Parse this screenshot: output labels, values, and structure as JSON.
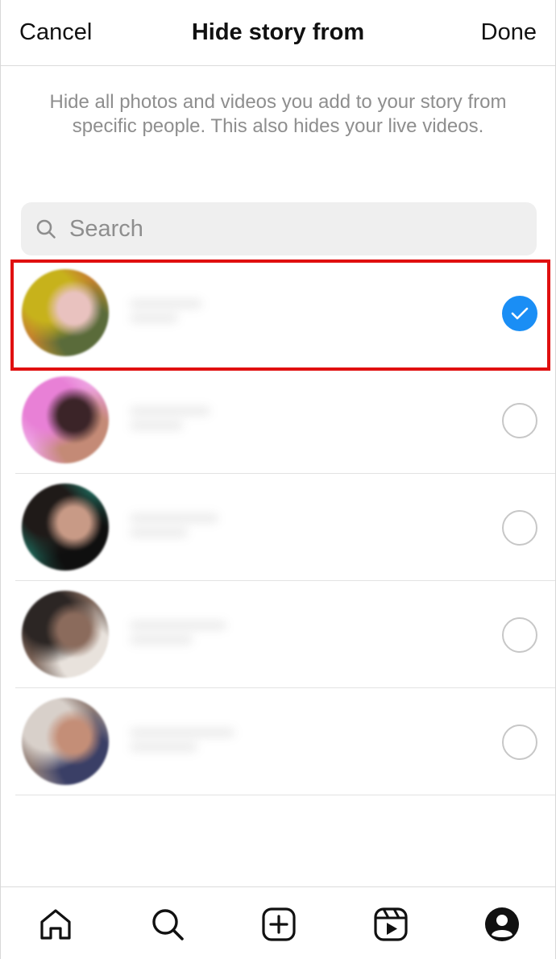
{
  "header": {
    "cancel_label": "Cancel",
    "title": "Hide story from",
    "done_label": "Done"
  },
  "description": "Hide all photos and videos you add to your story from specific people. This also hides your live videos.",
  "search": {
    "placeholder": "Search",
    "icon": "search-icon"
  },
  "people": [
    {
      "selected": true,
      "avatar_colors": [
        "#c7b21b",
        "#c2503e",
        "#e9c2bf",
        "#5a6b3a"
      ]
    },
    {
      "selected": false,
      "avatar_colors": [
        "#e880d6",
        "#f4c6ee",
        "#3b2428",
        "#c48a76"
      ]
    },
    {
      "selected": false,
      "avatar_colors": [
        "#1f1a18",
        "#1a9a84",
        "#c89a86",
        "#0f0f0f"
      ]
    },
    {
      "selected": false,
      "avatar_colors": [
        "#2c2624",
        "#c79c86",
        "#8b6b5c",
        "#e8e2dc"
      ]
    },
    {
      "selected": false,
      "avatar_colors": [
        "#d8d0ca",
        "#4a2b22",
        "#c48e77",
        "#3a3f66"
      ]
    }
  ],
  "colors": {
    "accent": "#1a8ef5",
    "highlight_border": "#e01010",
    "secondary_text": "#8e8e8e"
  },
  "nav": [
    {
      "icon": "home-icon"
    },
    {
      "icon": "search-icon"
    },
    {
      "icon": "create-icon"
    },
    {
      "icon": "reels-icon"
    },
    {
      "icon": "profile-icon"
    }
  ]
}
